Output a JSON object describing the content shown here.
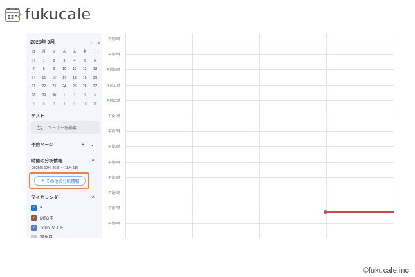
{
  "app": {
    "logo_text": "fukucale",
    "copyright": "©fukucale.inc"
  },
  "colors": {
    "sidebar_bg": "#f4f6fb",
    "highlight_border": "#e8824a",
    "accent": "#1a73e8",
    "now_indicator": "#c0504d"
  },
  "mini_calendar": {
    "title": "2025年 9月",
    "prev": "‹",
    "next": "›",
    "weekdays": [
      "日",
      "月",
      "火",
      "水",
      "木",
      "金",
      "土"
    ],
    "days": [
      [
        "31",
        "1",
        "2",
        "3",
        "4",
        "5",
        "6"
      ],
      [
        "7",
        "8",
        "9",
        "10",
        "11",
        "12",
        "13"
      ],
      [
        "14",
        "15",
        "16",
        "17",
        "18",
        "19",
        "20"
      ],
      [
        "21",
        "22",
        "23",
        "24",
        "25",
        "26",
        "27"
      ],
      [
        "28",
        "29",
        "30",
        "1",
        "2",
        "3",
        "4"
      ],
      [
        "5",
        "6",
        "7",
        "8",
        "9",
        "10",
        "11"
      ]
    ]
  },
  "guest": {
    "label": "ゲスト",
    "search_placeholder": "ユーザーを検索",
    "icon": "people-icon"
  },
  "booking": {
    "label": "予約ページ",
    "add": "+",
    "toggle": "⌄"
  },
  "analysis": {
    "label": "時間の分析情報",
    "toggle": "˄",
    "range": "2025年 10月 26日 〜 11月 1日",
    "button_label": "その他の分析情報",
    "button_icon": "trend-icon"
  },
  "my_calendars": {
    "label": "マイカレンダー",
    "toggle": "˄",
    "items": [
      {
        "name": "a",
        "color": "#1a73e8",
        "check": "✓"
      },
      {
        "name": "MTG用",
        "color": "#8d5a3a",
        "check": "✓"
      },
      {
        "name": "ToDo リスト",
        "color": "#4a7fd1",
        "check": "✓"
      },
      {
        "name": "誕生日",
        "color": "#c9ccd1",
        "check": ""
      }
    ]
  },
  "time_labels": [
    "午前8時",
    "午前9時",
    "午前10時",
    "午前11時",
    "午前12時",
    "午後1時",
    "午後2時",
    "午後3時",
    "午後4時",
    "午後5時",
    "午後6時",
    "午後7時",
    "午後8時"
  ]
}
